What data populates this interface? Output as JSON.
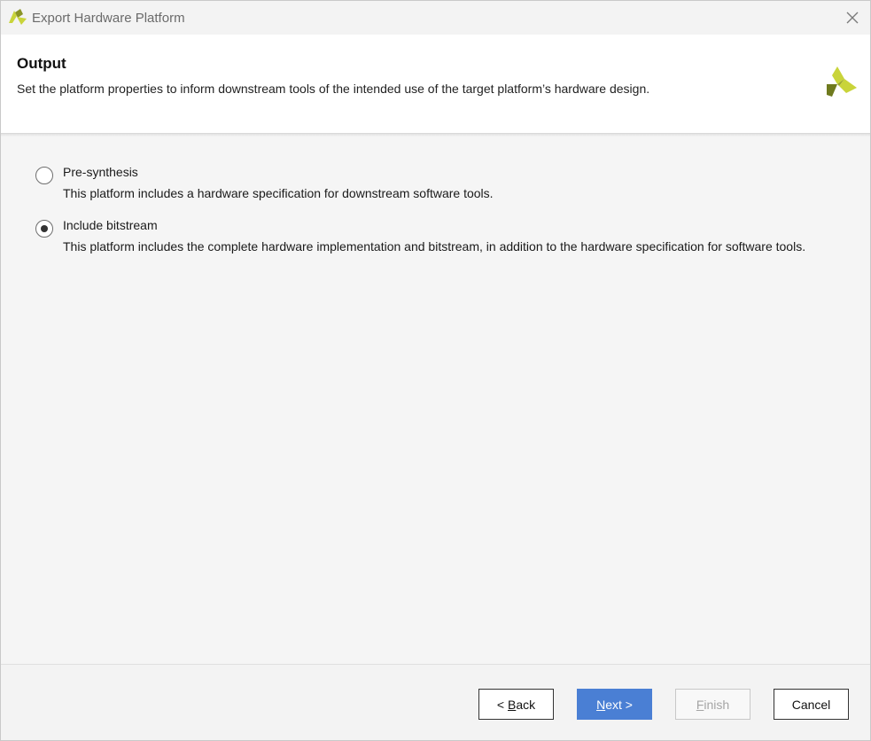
{
  "window": {
    "title": "Export Hardware Platform"
  },
  "header": {
    "title": "Output",
    "description": "Set the platform properties to inform downstream tools of the intended use of the target platform’s hardware design."
  },
  "options": [
    {
      "label": "Pre-synthesis",
      "description": "This platform includes a hardware specification for downstream software tools.",
      "selected": false
    },
    {
      "label": "Include bitstream",
      "description": "This platform includes the complete hardware implementation and bitstream, in addition to the hardware specification for software tools.",
      "selected": true
    }
  ],
  "buttons": {
    "back": {
      "prefix": "< ",
      "mnemonic": "B",
      "rest": "ack"
    },
    "next": {
      "mnemonic": "N",
      "rest": "ext >"
    },
    "finish": {
      "mnemonic": "F",
      "rest": "inish",
      "enabled": false
    },
    "cancel": {
      "label": "Cancel"
    }
  },
  "colors": {
    "accent": "#4a7fd4",
    "logo_light": "#c9d43a",
    "logo_dark": "#6f7a1e"
  },
  "icons": {
    "app": "xilinx-logo-icon",
    "close": "close-icon",
    "header_logo": "xilinx-logo-icon"
  }
}
